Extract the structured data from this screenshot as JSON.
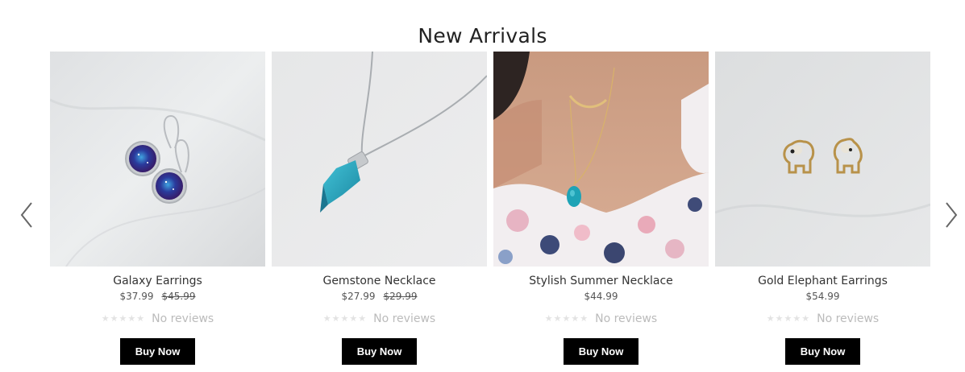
{
  "section": {
    "title": "New Arrivals"
  },
  "products": [
    {
      "title": "Galaxy Earrings",
      "price": "$37.99",
      "compare_price": "$45.99",
      "reviews": "No reviews",
      "stars": "★★★★★",
      "button": "Buy Now"
    },
    {
      "title": "Gemstone Necklace",
      "price": "$27.99",
      "compare_price": "$29.99",
      "reviews": "No reviews",
      "stars": "★★★★★",
      "button": "Buy Now"
    },
    {
      "title": "Stylish Summer Necklace",
      "price": "$44.99",
      "compare_price": "",
      "reviews": "No reviews",
      "stars": "★★★★★",
      "button": "Buy Now"
    },
    {
      "title": "Gold Elephant Earrings",
      "price": "$54.99",
      "compare_price": "",
      "reviews": "No reviews",
      "stars": "★★★★★",
      "button": "Buy Now"
    }
  ],
  "icons": {
    "prev": "chevron-left-icon",
    "next": "chevron-right-icon"
  },
  "colors": {
    "button_bg": "#000000",
    "button_text": "#ffffff",
    "text": "#222222",
    "muted": "#bbbbbb"
  }
}
